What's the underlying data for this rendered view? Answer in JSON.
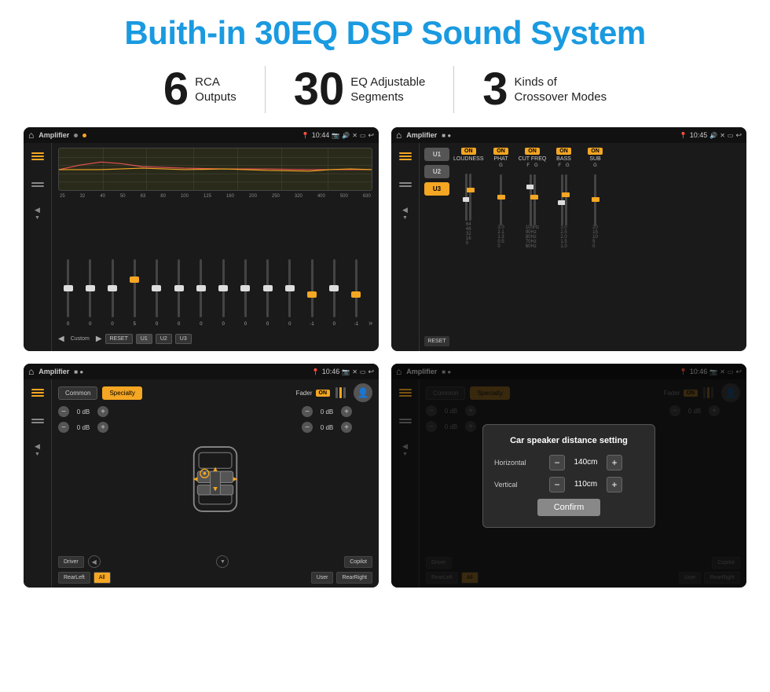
{
  "title": "Buith-in 30EQ DSP Sound System",
  "stats": [
    {
      "number": "6",
      "label": "RCA\nOutputs"
    },
    {
      "number": "30",
      "label": "EQ Adjustable\nSegments"
    },
    {
      "number": "3",
      "label": "Kinds of\nCrossover Modes"
    }
  ],
  "screens": {
    "eq": {
      "title": "Amplifier",
      "time": "10:44",
      "freq_labels": [
        "25",
        "32",
        "40",
        "50",
        "63",
        "80",
        "100",
        "125",
        "160",
        "200",
        "250",
        "320",
        "400",
        "500",
        "630"
      ],
      "slider_values": [
        "0",
        "0",
        "0",
        "5",
        "0",
        "0",
        "0",
        "0",
        "0",
        "0",
        "0",
        "-1",
        "0",
        "-1"
      ],
      "preset": "Custom",
      "buttons": [
        "RESET",
        "U1",
        "U2",
        "U3"
      ]
    },
    "crossover": {
      "title": "Amplifier",
      "time": "10:45",
      "u_buttons": [
        "U1",
        "U2",
        "U3"
      ],
      "channels": [
        {
          "on": true,
          "name": "LOUDNESS"
        },
        {
          "on": true,
          "name": "PHAT"
        },
        {
          "on": true,
          "name": "CUT FREQ"
        },
        {
          "on": true,
          "name": "BASS"
        },
        {
          "on": true,
          "name": "SUB"
        }
      ]
    },
    "specialty": {
      "title": "Amplifier",
      "time": "10:46",
      "tabs": [
        "Common",
        "Specialty"
      ],
      "active_tab": "Specialty",
      "fader_label": "Fader",
      "on_label": "ON",
      "db_values": [
        "0 dB",
        "0 dB",
        "0 dB",
        "0 dB"
      ],
      "buttons": [
        "Driver",
        "Copilot",
        "RearLeft",
        "All",
        "User",
        "RearRight"
      ]
    },
    "dialog": {
      "title": "Amplifier",
      "time": "10:46",
      "tabs": [
        "Common",
        "Specialty"
      ],
      "dialog_title": "Car speaker distance setting",
      "horizontal_label": "Horizontal",
      "horizontal_value": "140cm",
      "vertical_label": "Vertical",
      "vertical_value": "110cm",
      "confirm_label": "Confirm",
      "db_values": [
        "0 dB",
        "0 dB"
      ],
      "buttons": [
        "Driver",
        "Copilot",
        "RearLeft",
        "All",
        "User",
        "RearRight"
      ]
    }
  },
  "icons": {
    "home": "⌂",
    "music_eq": "≡",
    "waveform": "∿",
    "speaker": "◁",
    "back": "↩",
    "settings": "⚙",
    "person": "👤",
    "plus": "+",
    "minus": "−",
    "nav_prev": "◀",
    "nav_next": "▶",
    "play": "▶",
    "location": "📍",
    "camera": "📷"
  }
}
